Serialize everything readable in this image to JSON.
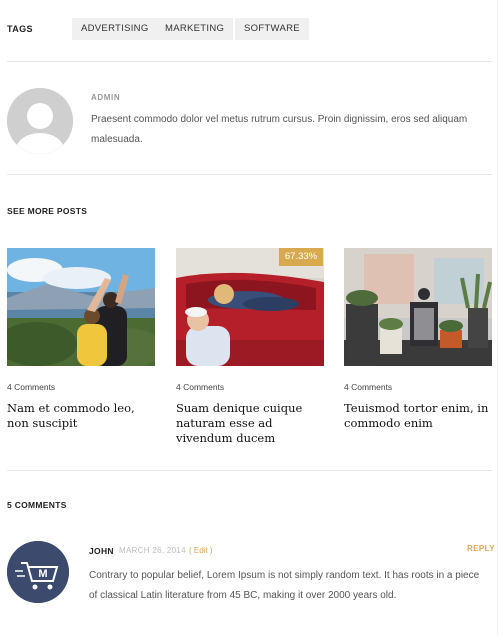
{
  "tags": {
    "label": "TAGS",
    "items": [
      "ADVERTISING",
      "MARKETING",
      "SOFTWARE"
    ]
  },
  "author": {
    "name": "ADMIN",
    "bio": "Praesent commodo dolor vel metus rutrum cursus. Proin dignissim, eros sed aliquam malesuada."
  },
  "more_posts": {
    "title": "SEE MORE POSTS",
    "posts": [
      {
        "comments": "4 Comments",
        "title": "Nam et commodo leo, non suscipit"
      },
      {
        "comments": "4 Comments",
        "title": "Suam denique cuique naturam esse ad vivendum ducem",
        "badge": "67.33%"
      },
      {
        "comments": "4 Comments",
        "title": "Teuismod tortor enim, in commodo enim"
      }
    ]
  },
  "comments": {
    "title": "5 COMMENTS",
    "items": [
      {
        "author": "JOHN",
        "date": "MARCH 26, 2014",
        "edit": "( Edit )",
        "reply": "REPLY",
        "text": "Contrary to popular belief, Lorem Ipsum is not simply random text. It has roots in a piece of classical Latin literature from 45 BC, making it over 2000 years old."
      }
    ]
  },
  "colors": {
    "accent": "#d8a94e",
    "tag_bg": "#f0f0f0",
    "rule": "#e6e6e6"
  }
}
